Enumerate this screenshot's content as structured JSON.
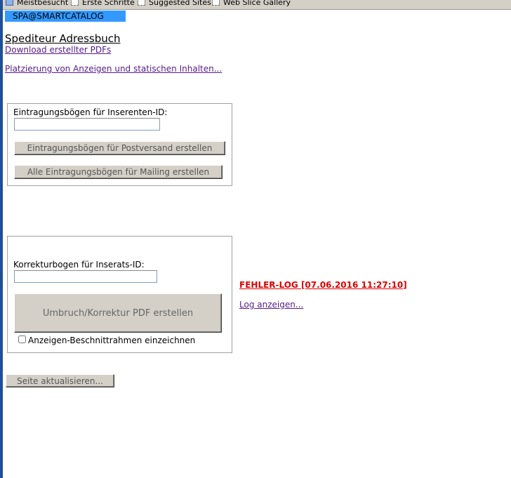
{
  "bookmarks": [
    {
      "label": "Meistbesucht",
      "icon": "page-icon"
    },
    {
      "label": "Erste Schritte",
      "icon": "bookmark-icon"
    },
    {
      "label": "Suggested Sites",
      "icon": "bookmark-icon"
    },
    {
      "label": "Web Slice Gallery",
      "icon": "bookmark-icon"
    }
  ],
  "app": {
    "banner": "SPA@SMARTCATALOG"
  },
  "page": {
    "title": "Spediteur Adressbuch",
    "download_link": "Download erstellter PDFs",
    "placement_link": "Platzierung von Anzeigen und statischen Inhalten..."
  },
  "entry_panel": {
    "label": "Eintragungsbögen für Inserenten-ID:",
    "input_value": "",
    "button_post": "Eintragungsbögen für Postversand erstellen",
    "button_mailing": "Alle Eintragungsbögen für Mailing erstellen"
  },
  "correction_panel": {
    "label": "Korrekturbogen für Inserats-ID:",
    "input_value": "",
    "button_pdf": "Umbruch/Korrektur PDF erstellen",
    "checkbox_label": "Anzeigen-Beschnittrahmen einzeichnen",
    "checkbox_checked": false
  },
  "log": {
    "error_title": "FEHLER-LOG [07.06.2016 11:27:10]",
    "show_log": "Log anzeigen..."
  },
  "footer": {
    "refresh_button": "Seite aktualisieren..."
  },
  "colors": {
    "banner": "#3399ff",
    "error": "#dd0000",
    "link": "#551a8b",
    "button_face": "#d4d0c8"
  }
}
